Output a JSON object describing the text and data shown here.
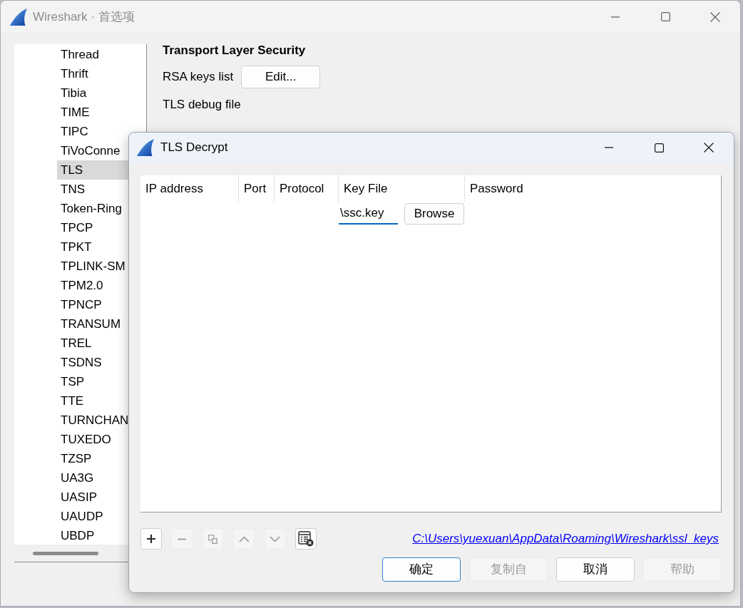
{
  "window": {
    "title": "Wireshark · 首选项"
  },
  "tree": {
    "items": [
      {
        "label": "Thread",
        "selected": false
      },
      {
        "label": "Thrift",
        "selected": false
      },
      {
        "label": "Tibia",
        "selected": false
      },
      {
        "label": "TIME",
        "selected": false
      },
      {
        "label": "TIPC",
        "selected": false
      },
      {
        "label": "TiVoConne",
        "selected": false
      },
      {
        "label": "TLS",
        "selected": true
      },
      {
        "label": "TNS",
        "selected": false
      },
      {
        "label": "Token-Ring",
        "selected": false
      },
      {
        "label": "TPCP",
        "selected": false
      },
      {
        "label": "TPKT",
        "selected": false
      },
      {
        "label": "TPLINK-SM",
        "selected": false
      },
      {
        "label": "TPM2.0",
        "selected": false
      },
      {
        "label": "TPNCP",
        "selected": false
      },
      {
        "label": "TRANSUM",
        "selected": false
      },
      {
        "label": "TREL",
        "selected": false
      },
      {
        "label": "TSDNS",
        "selected": false
      },
      {
        "label": "TSP",
        "selected": false
      },
      {
        "label": "TTE",
        "selected": false
      },
      {
        "label": "TURNCHAN",
        "selected": false
      },
      {
        "label": "TUXEDO",
        "selected": false
      },
      {
        "label": "TZSP",
        "selected": false
      },
      {
        "label": "UA3G",
        "selected": false
      },
      {
        "label": "UASIP",
        "selected": false
      },
      {
        "label": "UAUDP",
        "selected": false
      },
      {
        "label": "UBDP",
        "selected": false
      }
    ]
  },
  "settings": {
    "title": "Transport Layer Security",
    "rows": [
      {
        "kind": "button",
        "label": "RSA keys list",
        "button": "Edit..."
      },
      {
        "kind": "text",
        "label": "TLS debug file"
      }
    ]
  },
  "dialog": {
    "title": "TLS Decrypt",
    "table": {
      "columns": [
        "IP address",
        "Port",
        "Protocol",
        "Key File",
        "Password"
      ],
      "rows": [
        {
          "cells": [
            {
              "kind": "blank"
            },
            {
              "kind": "blank"
            },
            {
              "kind": "blank"
            },
            {
              "kind": "file",
              "value": "\\ssc.key",
              "focused": true,
              "button": "Browse"
            },
            {
              "kind": "blank"
            }
          ]
        }
      ]
    },
    "toolbar": [
      {
        "kind": "add",
        "disabled": false
      },
      {
        "kind": "remove",
        "disabled": true
      },
      {
        "kind": "copy",
        "disabled": true
      },
      {
        "kind": "move-up",
        "disabled": true
      },
      {
        "kind": "move-down",
        "disabled": true
      },
      {
        "kind": "clear",
        "disabled": false
      }
    ],
    "file_link": "C:\\Users\\yuexuan\\AppData\\Roaming\\Wireshark\\ssl_keys",
    "buttons": [
      {
        "label": "确定",
        "disabled": false,
        "focused": true
      },
      {
        "label": "复制自",
        "disabled": true,
        "focused": false
      },
      {
        "label": "取消",
        "disabled": false,
        "focused": false
      },
      {
        "label": "帮助",
        "disabled": true,
        "focused": false
      }
    ]
  }
}
